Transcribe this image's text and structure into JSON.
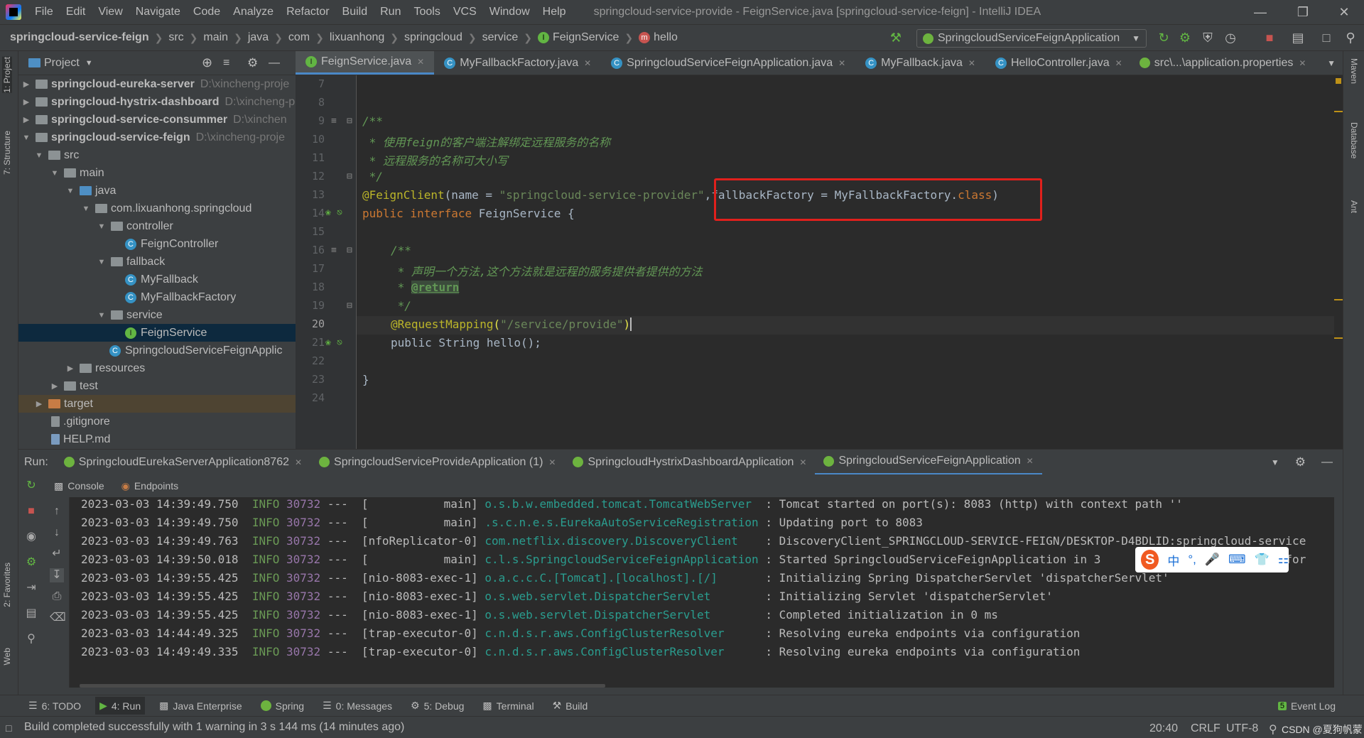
{
  "window": {
    "title": "springcloud-service-provide - FeignService.java [springcloud-service-feign] - IntelliJ IDEA",
    "menu": [
      "File",
      "Edit",
      "View",
      "Navigate",
      "Code",
      "Analyze",
      "Refactor",
      "Build",
      "Run",
      "Tools",
      "VCS",
      "Window",
      "Help"
    ]
  },
  "breadcrumb": [
    "springcloud-service-feign",
    "src",
    "main",
    "java",
    "com",
    "lixuanhong",
    "springcloud",
    "service",
    "FeignService",
    "hello"
  ],
  "run_config": "SpringcloudServiceFeignApplication",
  "project": {
    "header": "Project",
    "tree": [
      {
        "label": "springcloud-eureka-server",
        "path": "D:\\xincheng-proje",
        "bold": true
      },
      {
        "label": "springcloud-hystrix-dashboard",
        "path": "D:\\xincheng-p",
        "bold": true
      },
      {
        "label": "springcloud-service-consummer",
        "path": "D:\\xinchen",
        "bold": true
      },
      {
        "label": "springcloud-service-feign",
        "path": "D:\\xincheng-proje",
        "bold": true
      },
      {
        "label": "src"
      },
      {
        "label": "main"
      },
      {
        "label": "java"
      },
      {
        "label": "com.lixuanhong.springcloud"
      },
      {
        "label": "controller"
      },
      {
        "label": "FeignController"
      },
      {
        "label": "fallback"
      },
      {
        "label": "MyFallback"
      },
      {
        "label": "MyFallbackFactory"
      },
      {
        "label": "service"
      },
      {
        "label": "FeignService"
      },
      {
        "label": "SpringcloudServiceFeignApplic"
      },
      {
        "label": "resources"
      },
      {
        "label": "test"
      },
      {
        "label": "target"
      },
      {
        "label": ".gitignore"
      },
      {
        "label": "HELP.md"
      }
    ]
  },
  "editor_tabs": [
    "FeignService.java",
    "MyFallbackFactory.java",
    "SpringcloudServiceFeignApplication.java",
    "MyFallback.java",
    "HelloController.java",
    "src\\...\\application.properties"
  ],
  "editor": {
    "line_numbers": [
      "7",
      "8",
      "9",
      "10",
      "11",
      "12",
      "13",
      "14",
      "15",
      "16",
      "17",
      "18",
      "19",
      "20",
      "21",
      "22",
      "23",
      "24"
    ],
    "comment1_open": "/**",
    "comment1_l1": " * 使用feign的客户端注解绑定远程服务的名称",
    "comment1_l2": " * 远程服务的名称可大小写",
    "comment1_close": " */",
    "ann_feign": "@FeignClient",
    "ann_args_a": "(name = ",
    "ann_str": "\"springcloud-service-provider\"",
    "ann_args_b": ",fallbackFactory = MyFallbackFactory.",
    "ann_class_kw": "class",
    "ann_close": ")",
    "iface_kw": "public interface ",
    "iface_name": "FeignService {",
    "comment2_open": "/**",
    "comment2_l1": " * 声明一个方法,这个方法就是远程的服务提供者提供的方法",
    "comment2_star": " * ",
    "comment2_tag": "@return",
    "comment2_close": " */",
    "req_ann": "@RequestMapping",
    "req_open": "(",
    "req_str": "\"/service/provide\"",
    "req_close": ")",
    "method": "public String hello();",
    "brace": "}"
  },
  "run": {
    "label": "Run:",
    "tabs": [
      "SpringcloudEurekaServerApplication8762",
      "SpringcloudServiceProvideApplication (1)",
      "SpringcloudHystrixDashboardApplication",
      "SpringcloudServiceFeignApplication"
    ],
    "console_tabs": [
      "Console",
      "Endpoints"
    ],
    "logs": [
      {
        "ts": "2023-03-03 14:39:49.750",
        "lvl": "INFO",
        "pid": "30732",
        "thread": "---  [           main]",
        "logger": "o.s.b.w.embedded.tomcat.TomcatWebServer",
        "msg": ": Tomcat started on port(s): 8083 (http) with context path ''"
      },
      {
        "ts": "2023-03-03 14:39:49.750",
        "lvl": "INFO",
        "pid": "30732",
        "thread": "---  [           main]",
        "logger": ".s.c.n.e.s.EurekaAutoServiceRegistration",
        "msg": ": Updating port to 8083"
      },
      {
        "ts": "2023-03-03 14:39:49.763",
        "lvl": "INFO",
        "pid": "30732",
        "thread": "---  [nfoReplicator-0]",
        "logger": "com.netflix.discovery.DiscoveryClient",
        "msg": ": DiscoveryClient_SPRINGCLOUD-SERVICE-FEIGN/DESKTOP-D4BDLID:springcloud-service"
      },
      {
        "ts": "2023-03-03 14:39:50.018",
        "lvl": "INFO",
        "pid": "30732",
        "thread": "---  [           main]",
        "logger": "c.l.s.SpringcloudServiceFeignApplication",
        "msg": ": Started SpringcloudServiceFeignApplication in 3                       ing for"
      },
      {
        "ts": "2023-03-03 14:39:55.425",
        "lvl": "INFO",
        "pid": "30732",
        "thread": "---  [nio-8083-exec-1]",
        "logger": "o.a.c.c.C.[Tomcat].[localhost].[/]",
        "msg": ": Initializing Spring DispatcherServlet 'dispatcherServlet'"
      },
      {
        "ts": "2023-03-03 14:39:55.425",
        "lvl": "INFO",
        "pid": "30732",
        "thread": "---  [nio-8083-exec-1]",
        "logger": "o.s.web.servlet.DispatcherServlet",
        "msg": ": Initializing Servlet 'dispatcherServlet'"
      },
      {
        "ts": "2023-03-03 14:39:55.425",
        "lvl": "INFO",
        "pid": "30732",
        "thread": "---  [nio-8083-exec-1]",
        "logger": "o.s.web.servlet.DispatcherServlet",
        "msg": ": Completed initialization in 0 ms"
      },
      {
        "ts": "2023-03-03 14:44:49.325",
        "lvl": "INFO",
        "pid": "30732",
        "thread": "---  [trap-executor-0]",
        "logger": "c.n.d.s.r.aws.ConfigClusterResolver",
        "msg": ": Resolving eureka endpoints via configuration"
      },
      {
        "ts": "2023-03-03 14:49:49.335",
        "lvl": "INFO",
        "pid": "30732",
        "thread": "---  [trap-executor-0]",
        "logger": "c.n.d.s.r.aws.ConfigClusterResolver",
        "msg": ": Resolving eureka endpoints via configuration"
      }
    ]
  },
  "ime": {
    "logo": "S",
    "chars": [
      "中",
      "°,",
      "🎤",
      "⌨",
      "👕",
      "⚏"
    ]
  },
  "bottom_tools": [
    "6: TODO",
    "4: Run",
    "Java Enterprise",
    "Spring",
    "0: Messages",
    "5: Debug",
    "Terminal",
    "Build"
  ],
  "event_log": "Event Log",
  "event_log_count": "5",
  "status": {
    "message": "Build completed successfully with 1 warning in 3 s 144 ms (14 minutes ago)",
    "position": "20:40",
    "line_sep": "CRLF",
    "encoding": "UTF-8",
    "watermark": "CSDN @夏狗帆蒙"
  },
  "side_tabs": {
    "left": [
      "1: Project",
      "7: Structure",
      "2: Favorites",
      "Web"
    ],
    "right": [
      "Maven",
      "Database",
      "Ant"
    ]
  },
  "colors": {
    "accent": "#4a88c7",
    "highlight_box": "#e0201c",
    "bg_editor": "#2b2b2b",
    "bg_panel": "#3c3f41"
  }
}
